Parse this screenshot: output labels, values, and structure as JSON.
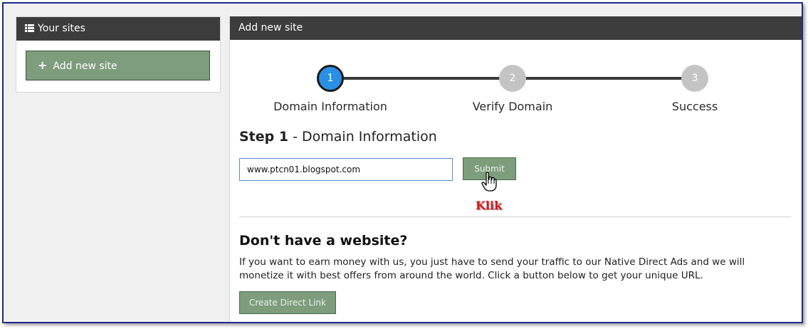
{
  "sidebar": {
    "header_icon": "list-icon",
    "title": "Your sites",
    "add_button_icon": "plus-icon",
    "add_button_label": "Add new site"
  },
  "main": {
    "title": "Add new site",
    "steps": [
      {
        "number": "1",
        "label": "Domain Information",
        "state": "active"
      },
      {
        "number": "2",
        "label": "Verify Domain",
        "state": "inactive"
      },
      {
        "number": "3",
        "label": "Success",
        "state": "inactive"
      }
    ],
    "step_heading_bold": "Step 1",
    "step_heading_rest": " - Domain Information",
    "domain_input": {
      "value": "www.ptcn01.blogspot.com",
      "placeholder": ""
    },
    "submit_label": "Submit",
    "annotation": "Klik",
    "no_site": {
      "title": "Don't have a website?",
      "description": "If you want to earn money with us, you just have to send your traffic to our Native Direct Ads and we will monetize it with best offers from around the world. Click a button below to get your unique URL.",
      "button_label": "Create Direct Link"
    }
  },
  "colors": {
    "header_bg": "#3c3c3c",
    "button_green": "#7d9d7c",
    "active_step": "#2a8fe6",
    "inactive_step": "#c4c4c4",
    "annotation_red": "#e2141a",
    "frame_border": "#1e2a8c"
  }
}
